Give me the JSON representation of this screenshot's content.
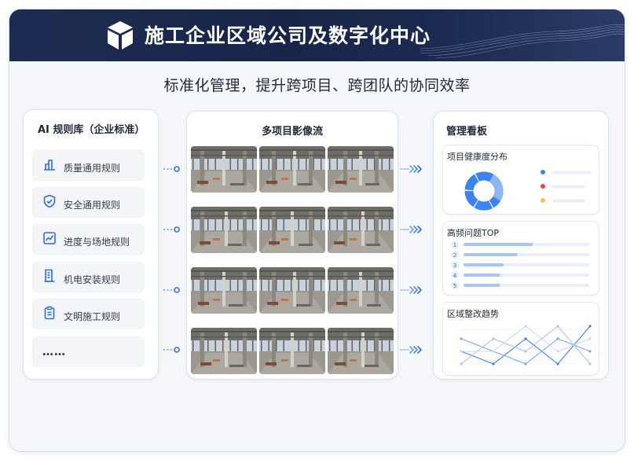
{
  "header": {
    "title": "施工企业区域公司及数字化中心",
    "subtitle": "标准化管理，提升跨项目、跨团队的协同效率",
    "logo_icon": "cube-icon"
  },
  "rules_panel": {
    "title": "AI 规则库（企业标准）",
    "items": [
      {
        "label": "质量通用规则",
        "icon": "quality-bars-icon"
      },
      {
        "label": "安全通用规则",
        "icon": "shield-check-icon"
      },
      {
        "label": "进度与场地规则",
        "icon": "trend-chart-icon"
      },
      {
        "label": "机电安装规则",
        "icon": "document-list-icon"
      },
      {
        "label": "文明施工规则",
        "icon": "clipboard-icon"
      }
    ],
    "more": "……"
  },
  "images_panel": {
    "title": "多项目影像流",
    "rows": 4,
    "per_row": 3
  },
  "dashboard_panel": {
    "title": "管理看板",
    "health": {
      "title": "项目健康度分布",
      "legend_colors": [
        "#3b82f6",
        "#ef4444",
        "#f5c542"
      ],
      "donut_color": "#3b82f6"
    },
    "top_issues": {
      "title": "高频问题TOP",
      "ranks": [
        "1",
        "2",
        "3",
        "4",
        "5"
      ],
      "fill_fractions": [
        0.55,
        0.43,
        0.32,
        0.29,
        0.29
      ]
    },
    "trend": {
      "title": "区域整改趋势",
      "series": [
        {
          "values": [
            2,
            1,
            3,
            1,
            4
          ]
        },
        {
          "values": [
            3,
            2,
            1,
            3,
            2
          ]
        },
        {
          "values": [
            1,
            3,
            2,
            4,
            1
          ]
        },
        {
          "values": [
            2,
            2,
            4,
            2,
            3
          ]
        }
      ]
    }
  },
  "colors": {
    "accent": "#3b82f6",
    "header_bg": "#1b2a50",
    "bar_track": "#e9eef7",
    "bar_fill": "#a9c5f5"
  }
}
